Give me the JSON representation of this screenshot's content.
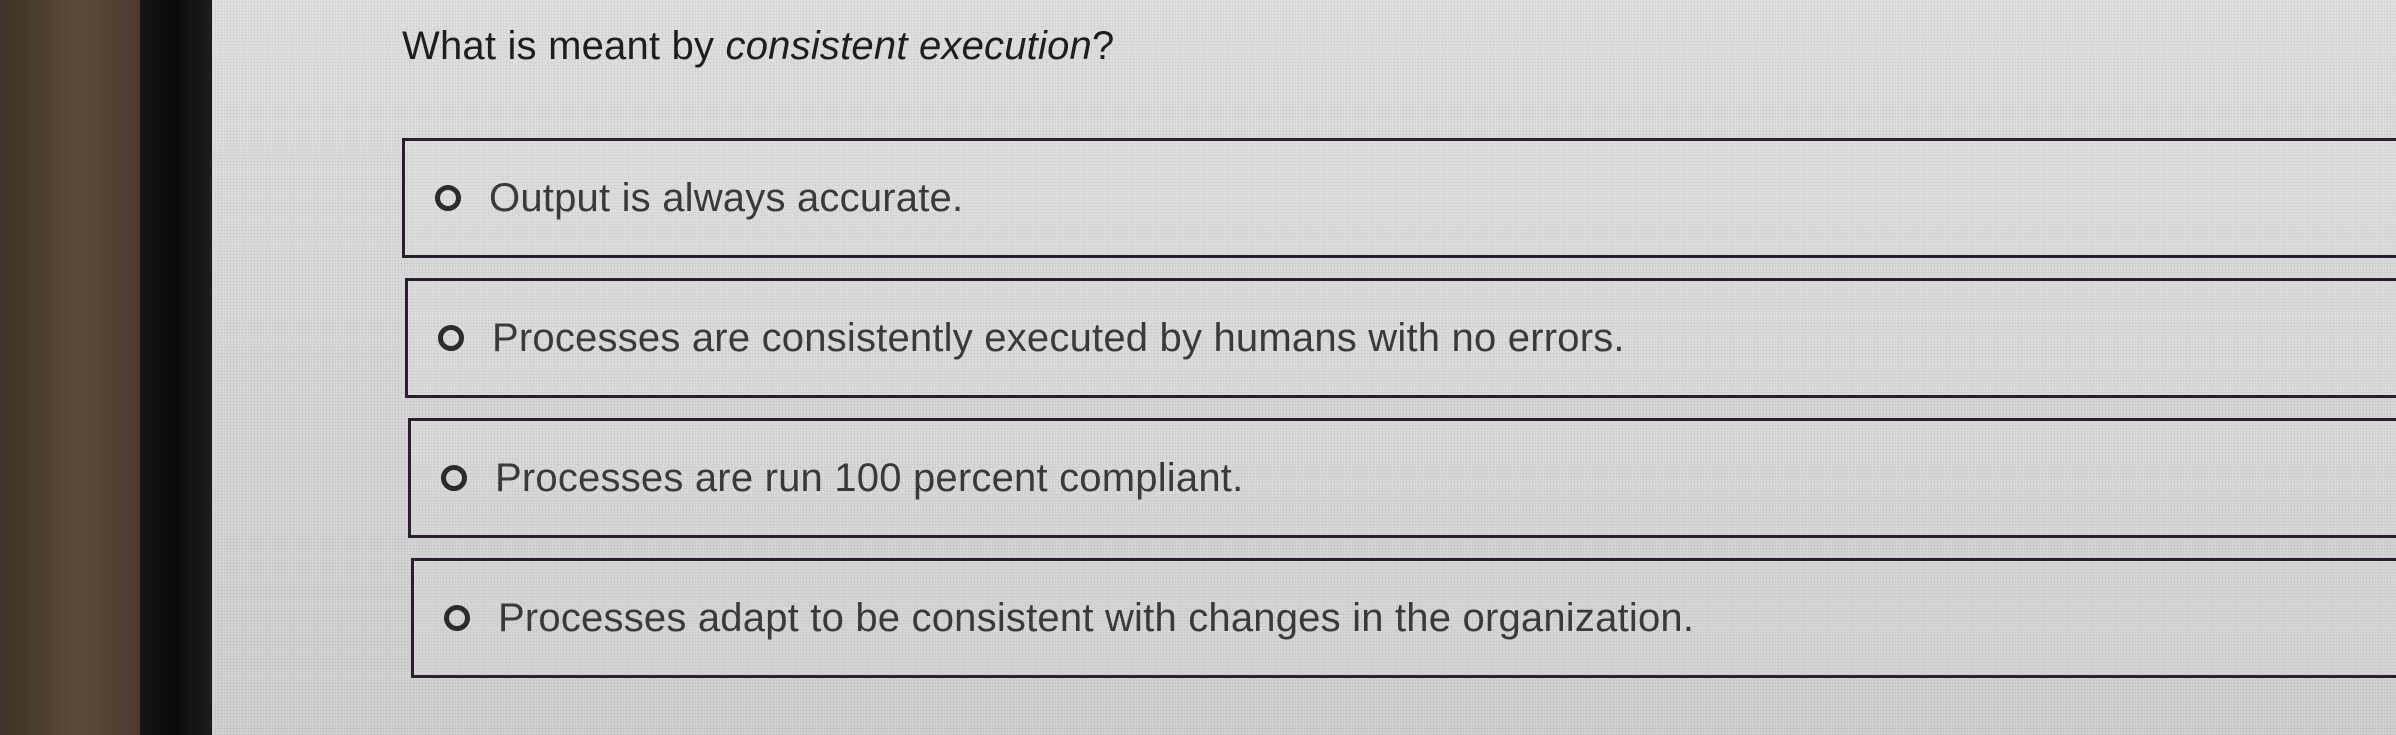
{
  "question": {
    "prefix": "What is meant by ",
    "emphasis": "consistent execution",
    "suffix": "?"
  },
  "options": [
    {
      "label": "Output is always accurate."
    },
    {
      "label": "Processes are consistently executed by humans with no errors."
    },
    {
      "label": "Processes are run 100 percent compliant."
    },
    {
      "label": "Processes adapt to be consistent with changes in the organization."
    }
  ]
}
